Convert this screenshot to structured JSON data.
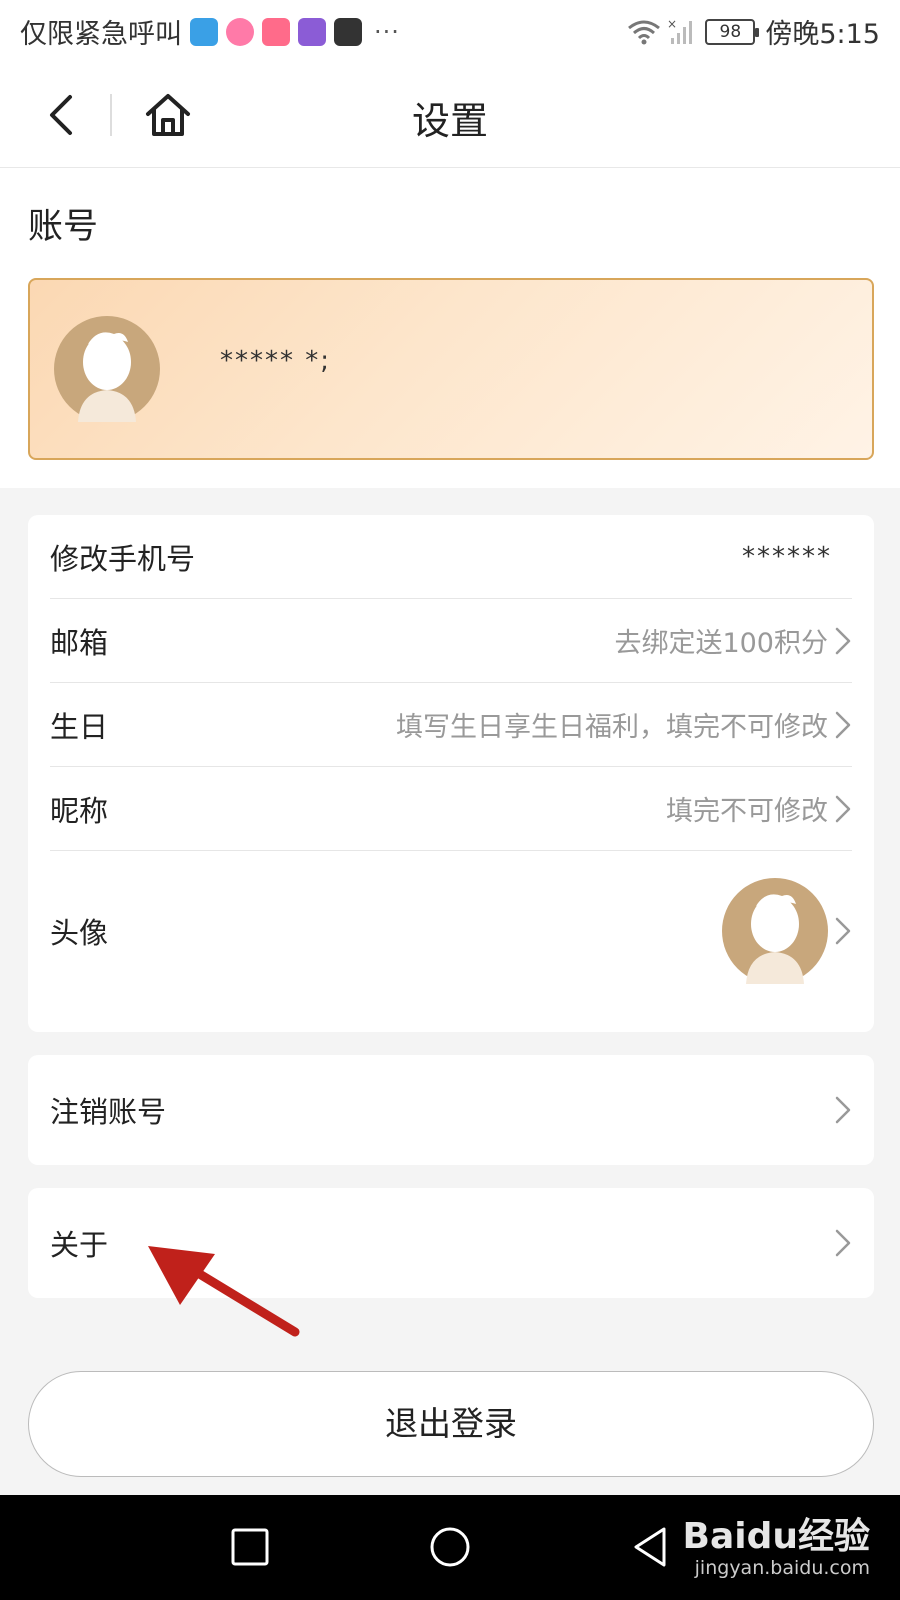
{
  "status_bar": {
    "carrier": "仅限紧急呼叫",
    "app_icons": [
      "bookmark-app-icon",
      "kids-app-icon",
      "pig-app-icon",
      "circle-app-icon",
      "huawei-store-icon"
    ],
    "more": "···",
    "battery": "98",
    "time": "傍晚5:15"
  },
  "nav": {
    "title": "设置"
  },
  "account": {
    "heading": "账号",
    "masked_name": "*****     *;"
  },
  "settings": {
    "phone": {
      "label": "修改手机号",
      "value": "******"
    },
    "email": {
      "label": "邮箱",
      "value": "去绑定送100积分"
    },
    "birthday": {
      "label": "生日",
      "value": "填写生日享生日福利，填完不可修改"
    },
    "nickname": {
      "label": "昵称",
      "value": "填完不可修改"
    },
    "avatar": {
      "label": "头像"
    }
  },
  "cancel_account": {
    "label": "注销账号"
  },
  "about": {
    "label": "关于"
  },
  "logout": {
    "label": "退出登录"
  },
  "watermark": {
    "brand": "Baidu经验",
    "url": "jingyan.baidu.com"
  },
  "colors": {
    "card_border": "#d8a65a",
    "avatar_bg": "#c8a77c",
    "arrow": "#c0211b"
  }
}
